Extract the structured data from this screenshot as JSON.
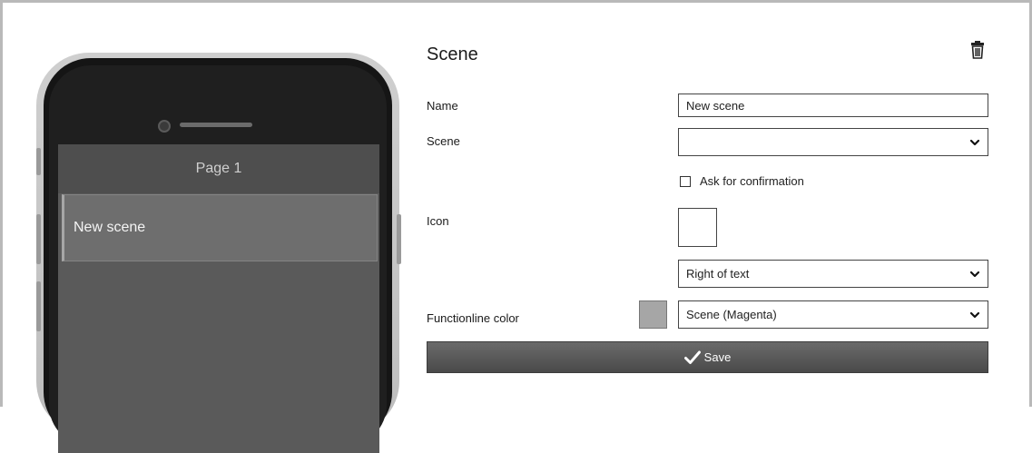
{
  "preview": {
    "page_title": "Page 1",
    "scene_item_label": "New scene"
  },
  "form": {
    "title": "Scene",
    "delete_icon": "trash-icon",
    "name": {
      "label": "Name",
      "value": "New scene"
    },
    "scene": {
      "label": "Scene",
      "selected": ""
    },
    "confirmation": {
      "label": "Ask for confirmation",
      "checked": false
    },
    "icon": {
      "label": "Icon",
      "position_selected": "Right of text"
    },
    "functionline": {
      "label": "Functionline color",
      "selected": "Scene (Magenta)",
      "swatch_color": "#a6a6a6"
    },
    "save": {
      "label": "Save",
      "icon": "checkmark-icon"
    }
  }
}
